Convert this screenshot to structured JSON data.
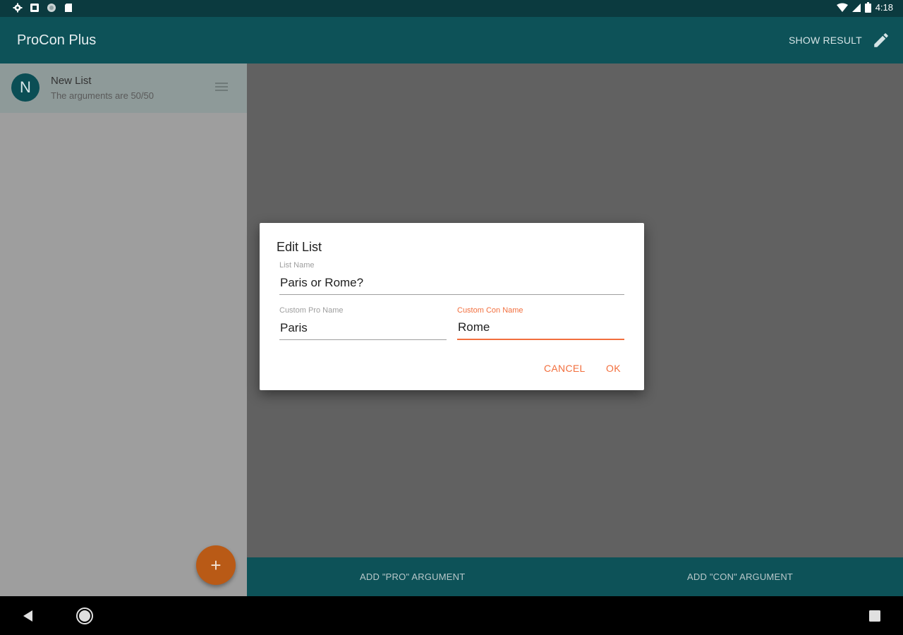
{
  "status_bar": {
    "time": "4:18",
    "left_icons": [
      "settings-icon",
      "notification-icon",
      "sync-icon",
      "sd-card-icon"
    ],
    "right_icons": [
      "wifi-icon",
      "signal-icon",
      "battery-icon"
    ]
  },
  "app_bar": {
    "title": "ProCon Plus",
    "show_result_label": "SHOW RESULT",
    "edit_icon": "pencil-icon"
  },
  "lists": [
    {
      "initial": "N",
      "title": "New List",
      "subtitle": "The arguments are 50/50"
    }
  ],
  "fab": {
    "label": "+"
  },
  "bottom_actions": {
    "add_pro": "ADD \"PRO\" ARGUMENT",
    "add_con": "ADD \"CON\" ARGUMENT"
  },
  "dialog": {
    "title": "Edit List",
    "list_name_label": "List Name",
    "list_name_value": "Paris or Rome?",
    "pro_name_label": "Custom Pro Name",
    "pro_name_value": "Paris",
    "con_name_label": "Custom Con Name",
    "con_name_value": "Rome",
    "cancel_label": "CANCEL",
    "ok_label": "OK"
  },
  "colors": {
    "primary": "#0d5258",
    "accent": "#f26f3e",
    "fab": "#b95a16"
  }
}
